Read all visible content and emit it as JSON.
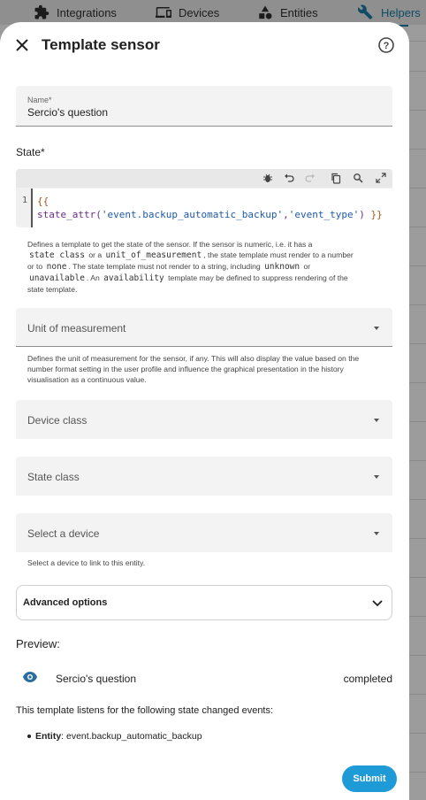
{
  "background": {
    "tabs": [
      {
        "label": "Integrations",
        "icon": "puzzle-icon"
      },
      {
        "label": "Devices",
        "icon": "devices-icon"
      },
      {
        "label": "Entities",
        "icon": "shapes-icon"
      },
      {
        "label": "Helpers",
        "icon": "tools-icon",
        "active": true
      }
    ]
  },
  "dialog": {
    "title": "Template sensor",
    "name_field": {
      "label": "Name*",
      "value": "Sercio's question"
    },
    "state_label": "State*",
    "code": {
      "line_number": "1",
      "line1": "{{",
      "func": "state_attr(",
      "arg1": "'event.backup_automatic_backup'",
      "comma": ",",
      "arg2": "'event_type'",
      "close": ")",
      "end": "}}"
    },
    "state_help": {
      "p1": "Defines a template to get the state of the sensor. If the sensor is numeric, i.e. it has a",
      "code1": "state class",
      "p2": "or a",
      "code2": "unit_of_measurement",
      "p3": ", the state template must render to a number",
      "p4": "or to",
      "code3": "none",
      "p5": ". The state template must not render to a string, including",
      "code4": "unknown",
      "p6": "or",
      "code5": "unavailable",
      "p7": ". An",
      "code6": "availability",
      "p8": "template may be defined to suppress rendering of the",
      "p9": "state template."
    },
    "unit_field": {
      "placeholder": "Unit of measurement"
    },
    "unit_help": [
      "Defines the unit of measurement for the sensor, if any. This will also display the value based on the",
      "number format setting in the user profile and influence the graphical presentation in the history",
      "visualisation as a continuous value."
    ],
    "device_class_field": {
      "placeholder": "Device class"
    },
    "state_class_field": {
      "placeholder": "State class"
    },
    "device_field": {
      "placeholder": "Select a device"
    },
    "device_help": "Select a device to link to this entity.",
    "advanced": {
      "label": "Advanced options"
    },
    "preview": {
      "title": "Preview:",
      "name": "Sercio's question",
      "state": "completed",
      "listens": "This template listens for the following state changed events:",
      "entity_label": "Entity",
      "entity_value": ": event.backup_automatic_backup"
    },
    "submit_label": "Submit"
  },
  "colors": {
    "accent": "#1e9bd6",
    "eye": "#2a6ea0"
  }
}
